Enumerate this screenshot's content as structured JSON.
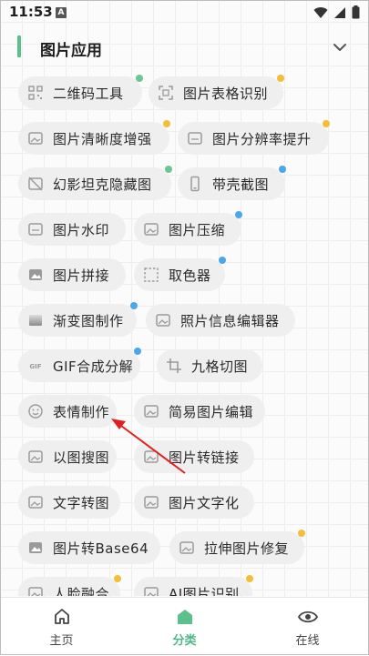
{
  "status": {
    "time": "11:53",
    "notif_badge": "A"
  },
  "section": {
    "title": "图片应用"
  },
  "chips": [
    {
      "label": "二维码工具",
      "icon": "qr-code-icon",
      "dot": "green"
    },
    {
      "label": "图片表格识别",
      "icon": "table-scan-icon",
      "dot": "yellow"
    },
    {
      "label": "图片清晰度增强",
      "icon": "image-enhance-icon",
      "dot": "yellow"
    },
    {
      "label": "图片分辨率提升",
      "icon": "resolution-icon",
      "dot": "yellow"
    },
    {
      "label": "幻影坦克隐藏图",
      "icon": "hidden-image-icon",
      "dot": "green"
    },
    {
      "label": "带壳截图",
      "icon": "phone-frame-icon",
      "dot": "blue"
    },
    {
      "label": "图片水印",
      "icon": "watermark-icon",
      "dot": null
    },
    {
      "label": "图片压缩",
      "icon": "compress-icon",
      "dot": "blue"
    },
    {
      "label": "图片拼接",
      "icon": "image-stitch-icon",
      "dot": null
    },
    {
      "label": "取色器",
      "icon": "color-picker-icon",
      "dot": "blue"
    },
    {
      "label": "渐变图制作",
      "icon": "gradient-icon",
      "dot": "blue"
    },
    {
      "label": "照片信息编辑器",
      "icon": "photo-info-icon",
      "dot": null
    },
    {
      "label": "GIF合成分解",
      "icon": "gif-icon",
      "icon_text": "GIF",
      "dot": "blue"
    },
    {
      "label": "九格切图",
      "icon": "crop-grid-icon",
      "dot": null
    },
    {
      "label": "表情制作",
      "icon": "emoji-icon",
      "dot": null
    },
    {
      "label": "简易图片编辑",
      "icon": "image-edit-icon",
      "dot": null
    },
    {
      "label": "以图搜图",
      "icon": "image-search-icon",
      "dot": null
    },
    {
      "label": "图片转链接",
      "icon": "image-link-icon",
      "dot": null
    },
    {
      "label": "文字转图",
      "icon": "text-to-image-icon",
      "dot": null
    },
    {
      "label": "图片文字化",
      "icon": "image-to-text-icon",
      "dot": null
    },
    {
      "label": "图片转Base64",
      "icon": "base64-icon",
      "dot": null
    },
    {
      "label": "拉伸图片修复",
      "icon": "stretch-fix-icon",
      "dot": "yellow"
    },
    {
      "label": "人脸融合",
      "icon": "face-merge-icon",
      "dot": "yellow"
    },
    {
      "label": "AI图片识别",
      "icon": "ai-recognize-icon",
      "dot": "yellow"
    }
  ],
  "nav": [
    {
      "label": "主页",
      "icon": "home-icon",
      "active": false
    },
    {
      "label": "分类",
      "icon": "category-icon",
      "active": true
    },
    {
      "label": "在线",
      "icon": "eye-icon",
      "active": false
    }
  ],
  "colors": {
    "accent": "#5cc08d",
    "dot_green": "#6dc592",
    "dot_yellow": "#f4bd3a",
    "dot_blue": "#4aa8e8",
    "annotation_arrow": "#e02020"
  }
}
